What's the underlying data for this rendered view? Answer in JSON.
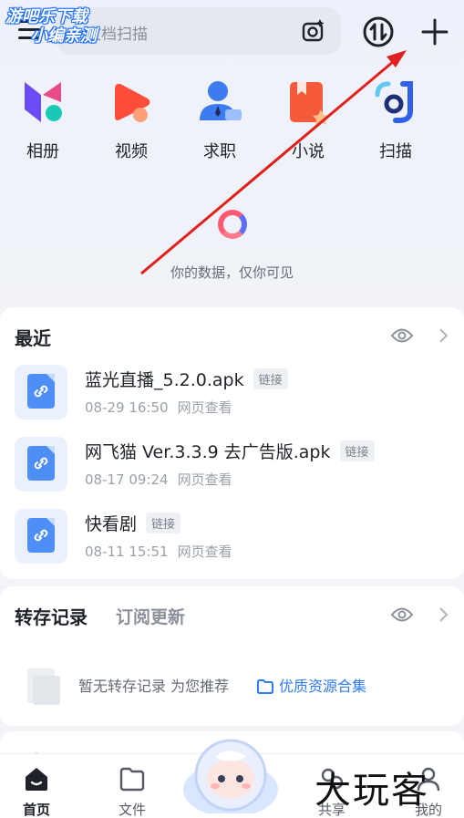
{
  "watermark_top_left": {
    "line1": "游吧乐下载",
    "line2": "小编亲测"
  },
  "search": {
    "text": "文档扫描",
    "icon": "camera-sparkle-icon"
  },
  "header": {
    "sync_icon": "sync-transfer-icon",
    "add_icon": "plus-icon"
  },
  "apps": [
    {
      "label": "相册",
      "icon": "album-icon"
    },
    {
      "label": "视频",
      "icon": "video-play-icon"
    },
    {
      "label": "求职",
      "icon": "job-person-icon"
    },
    {
      "label": "小说",
      "icon": "novel-book-icon"
    },
    {
      "label": "扫描",
      "icon": "scan-icon"
    }
  ],
  "privacy_text": "你的数据，仅你可见",
  "recent": {
    "title": "最近",
    "files": [
      {
        "name": "蓝光直播_5.2.0.apk",
        "tag": "链接",
        "time": "08-29 16:50",
        "source": "网页查看"
      },
      {
        "name": "网飞猫 Ver.3.3.9 去广告版.apk",
        "tag": "链接",
        "time": "08-17 09:24",
        "source": "网页查看"
      },
      {
        "name": "快看剧",
        "tag": "链接",
        "time": "08-11 15:51",
        "source": "网页查看"
      }
    ]
  },
  "transfer": {
    "title": "转存记录",
    "subtitle": "订阅更新",
    "empty_text": "暂无转存记录 为您推荐",
    "resource_link": "优质资源合集"
  },
  "recall": {
    "title": "回忆"
  },
  "tabs": [
    {
      "label": "首页",
      "icon": "home-icon"
    },
    {
      "label": "文件",
      "icon": "folder-icon"
    },
    {
      "label": "共享",
      "icon": "share-icon"
    },
    {
      "label": "我的",
      "icon": "profile-icon"
    }
  ],
  "watermark_bottom_right": "大玩客",
  "colors": {
    "accent": "#2f7cf6",
    "arrow": "#e0201c",
    "background": "#f2f4f8"
  }
}
